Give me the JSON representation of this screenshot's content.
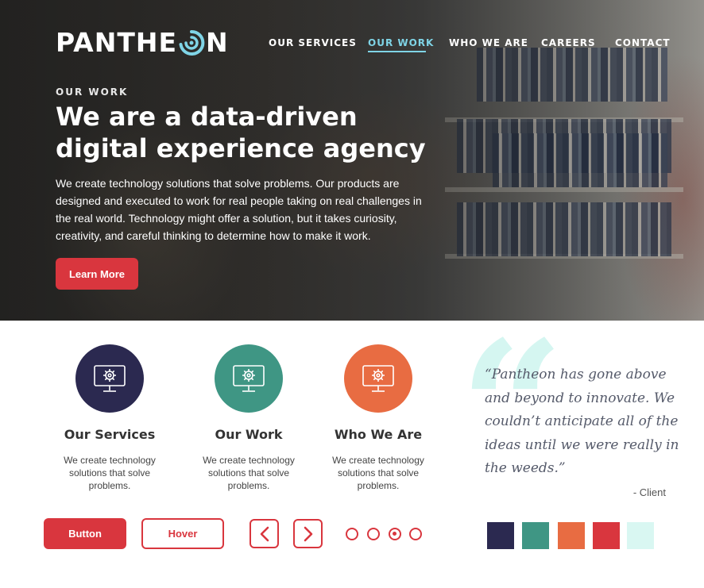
{
  "brand": {
    "name_before": "PANTHE",
    "name_after": "N",
    "icon": "gear-o-logo-icon"
  },
  "nav": {
    "items": [
      {
        "label": "OUR SERVICES"
      },
      {
        "label": "OUR WORK",
        "active": true
      },
      {
        "label": "WHO WE ARE"
      },
      {
        "label": "CAREERS"
      },
      {
        "label": "CONTACT"
      }
    ]
  },
  "hero": {
    "eyebrow": "OUR WORK",
    "headline_line1": "We are a data-driven",
    "headline_line2": "digital experience agency",
    "intro": "We create technology solutions that solve problems.  Our products are designed and executed to work for real people taking on real challenges in the real world.  Technology might offer a solution, but it takes curiosity, creativity, and careful thinking to determine how to make it work.",
    "cta_label": "Learn More"
  },
  "features": [
    {
      "title": "Our Services",
      "description": "We create technology solutions that solve problems.",
      "color": "#2b2950",
      "icon": "monitor-gear-icon"
    },
    {
      "title": "Our Work",
      "description": "We create technology solutions that solve problems.",
      "color": "#3f9684",
      "icon": "monitor-gear-icon"
    },
    {
      "title": "Who We Are",
      "description": "We create technology solutions that solve problems.",
      "color": "#e86c42",
      "icon": "monitor-gear-icon"
    }
  ],
  "testimonial": {
    "quote": "“Pantheon has gone above and beyond to innovate. We couldn’t anticipate all of the ideas until we were really in the weeds.”",
    "author": "- Client"
  },
  "ui_kit": {
    "button_label": "Button",
    "hover_label": "Hover",
    "prev_icon": "chevron-left-icon",
    "next_icon": "chevron-right-icon",
    "pagination": {
      "total": 4,
      "active": 3
    },
    "swatches": [
      "#2b2950",
      "#3f9684",
      "#e86c42",
      "#d9363e",
      "#d9f7f2"
    ]
  },
  "colors": {
    "accent": "#d9363e",
    "nav_active": "#7fd4e6"
  }
}
